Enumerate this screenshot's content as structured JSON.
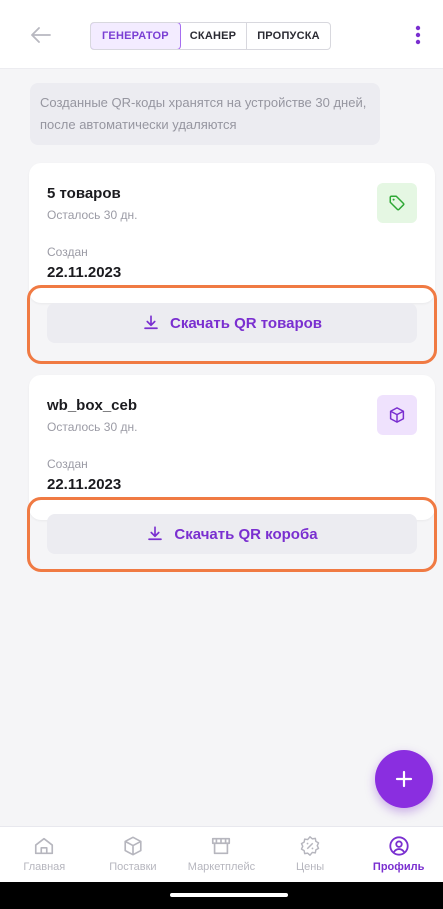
{
  "header": {
    "tabs": [
      {
        "label": "ГЕНЕРАТОР",
        "active": true
      },
      {
        "label": "СКАНЕР",
        "active": false
      },
      {
        "label": "ПРОПУСКА",
        "active": false
      }
    ]
  },
  "info": {
    "text": "Созданные QR-коды хранятся на устройстве 30 дней, после автоматически удаляются"
  },
  "cards": [
    {
      "title": "5 товаров",
      "remaining": "Осталось 30 дн.",
      "created_label": "Создан",
      "created_date": "22.11.2023",
      "badge_icon": "tag-icon",
      "download_label": "Скачать QR товаров"
    },
    {
      "title": "wb_box_ceb",
      "remaining": "Осталось 30 дн.",
      "created_label": "Создан",
      "created_date": "22.11.2023",
      "badge_icon": "box-icon",
      "download_label": "Скачать QR короба"
    }
  ],
  "bottom_nav": [
    {
      "label": "Главная",
      "icon": "home-icon",
      "active": false
    },
    {
      "label": "Поставки",
      "icon": "package-icon",
      "active": false
    },
    {
      "label": "Маркетплейс",
      "icon": "store-icon",
      "active": false
    },
    {
      "label": "Цены",
      "icon": "discount-icon",
      "active": false
    },
    {
      "label": "Профиль",
      "icon": "profile-icon",
      "active": true
    }
  ],
  "colors": {
    "accent": "#7a2fd0",
    "fab": "#8a2ee0",
    "highlight": "#f07a43"
  }
}
